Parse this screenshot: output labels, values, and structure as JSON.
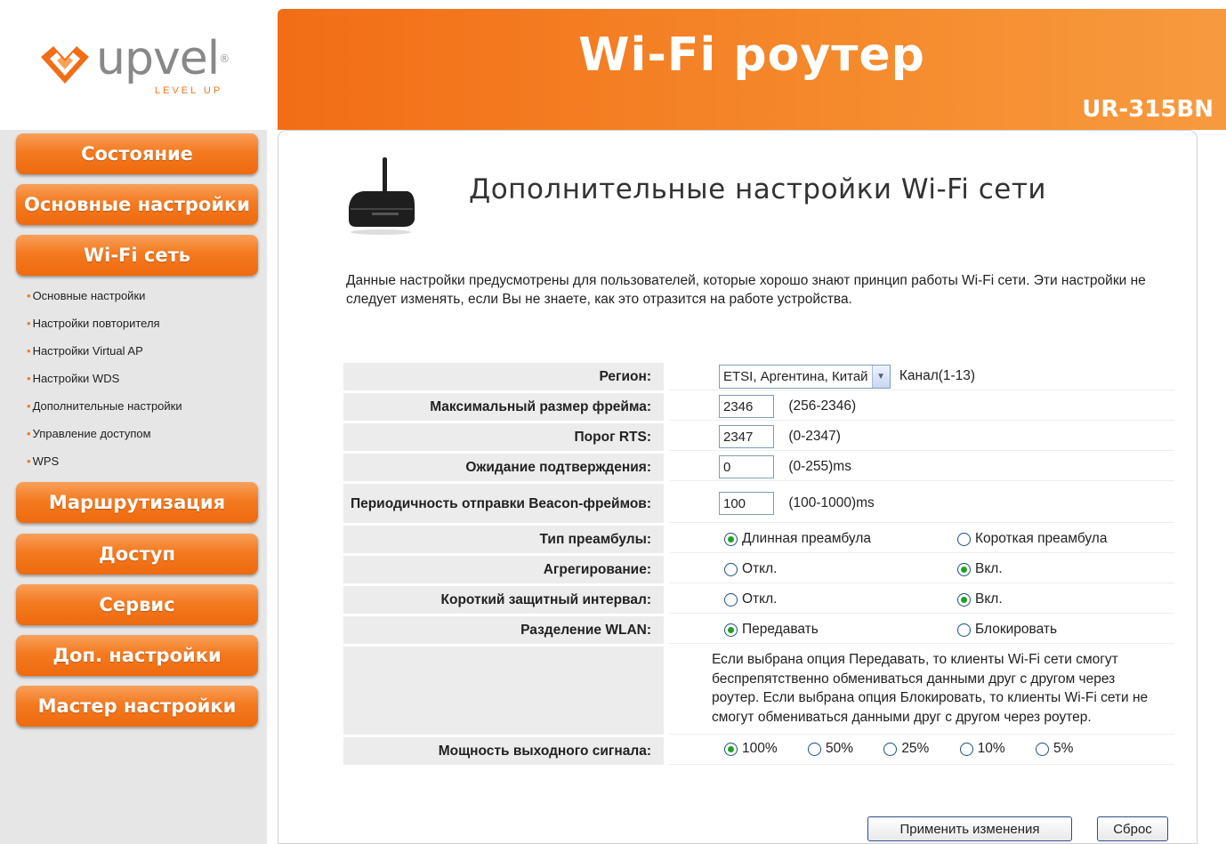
{
  "header": {
    "logo_text": "upvel",
    "logo_tagline": "LEVEL UP",
    "title": "Wi-Fi роутер",
    "model": "UR-315BN",
    "brand_color": "#f26d16"
  },
  "sidebar": {
    "buttons": [
      {
        "label": "Состояние"
      },
      {
        "label": "Основные настройки"
      },
      {
        "label": "Wi-Fi сеть"
      },
      {
        "label": "Маршрутизация"
      },
      {
        "label": "Доступ"
      },
      {
        "label": "Сервис"
      },
      {
        "label": "Доп. настройки"
      },
      {
        "label": "Мастер настройки"
      }
    ],
    "sub_items": [
      {
        "label": "Основные настройки"
      },
      {
        "label": "Настройки повторителя"
      },
      {
        "label": "Настройки Virtual AP"
      },
      {
        "label": "Настройки WDS"
      },
      {
        "label": "Дополнительные настройки"
      },
      {
        "label": "Управление доступом"
      },
      {
        "label": "WPS"
      }
    ]
  },
  "main": {
    "title": "Дополнительные настройки Wi-Fi сети",
    "intro": "Данные настройки предусмотрены для пользователей, которые хорошо знают принцип работы Wi-Fi сети. Эти настройки не следует изменять, если Вы не знаете, как это отразится на работе устройства.",
    "region": {
      "label": "Регион:",
      "value": "ETSI, Аргентина, Китай",
      "hint": "Канал(1-13)"
    },
    "frame_size": {
      "label": "Максимальный размер фрейма:",
      "value": "2346",
      "hint": "(256-2346)"
    },
    "rts": {
      "label": "Порог RTS:",
      "value": "2347",
      "hint": "(0-2347)"
    },
    "ack": {
      "label": "Ожидание подтверждения:",
      "value": "0",
      "hint": "(0-255)ms"
    },
    "beacon": {
      "label": "Периодичность отправки Beacon-фреймов:",
      "value": "100",
      "hint": "(100-1000)ms"
    },
    "preamble": {
      "label": "Тип преамбулы:",
      "opt1": "Длинная преамбула",
      "opt2": "Короткая преамбула",
      "selected": "opt1"
    },
    "aggregation": {
      "label": "Агрегирование:",
      "opt1": "Откл.",
      "opt2": "Вкл.",
      "selected": "opt2"
    },
    "guard": {
      "label": "Короткий защитный интервал:",
      "opt1": "Откл.",
      "opt2": "Вкл.",
      "selected": "opt2"
    },
    "wlan_sep": {
      "label": "Разделение WLAN:",
      "opt1": "Передавать",
      "opt2": "Блокировать",
      "selected": "opt1"
    },
    "wlan_note": "Если выбрана опция Передавать, то клиенты Wi-Fi сети смогут беспрепятственно обмениваться данными друг с другом через роутер. Если выбрана опция Блокировать, то клиенты Wi-Fi сети не смогут обмениваться данными друг с другом через роутер.",
    "power": {
      "label": "Мощность выходного сигнала:",
      "options": [
        "100%",
        "50%",
        "25%",
        "10%",
        "5%"
      ],
      "selected": "100%"
    },
    "apply_label": "Применить изменения",
    "reset_label": "Сброс"
  }
}
